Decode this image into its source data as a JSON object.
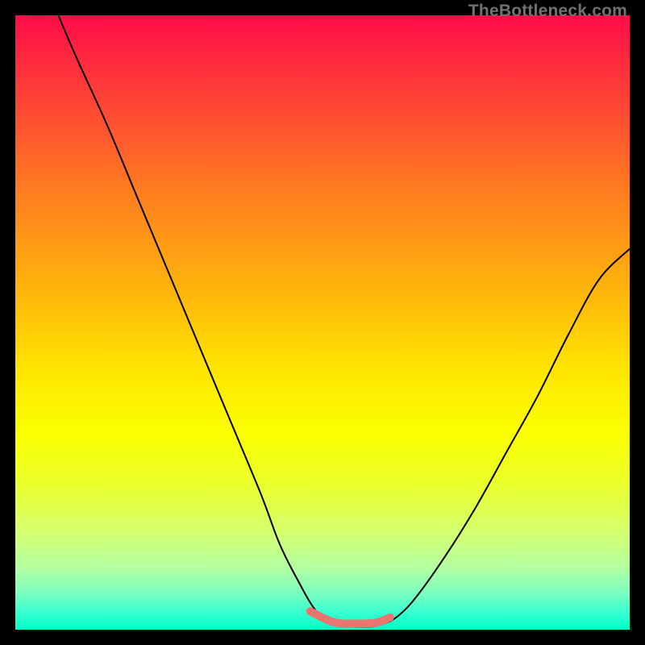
{
  "watermark": "TheBottleneck.com",
  "chart_data": {
    "type": "line",
    "title": "",
    "xlabel": "",
    "ylabel": "",
    "xlim": [
      0,
      100
    ],
    "ylim": [
      0,
      100
    ],
    "grid": false,
    "legend": false,
    "series": [
      {
        "name": "curve",
        "x": [
          7,
          10,
          15,
          20,
          25,
          30,
          35,
          40,
          43,
          46,
          49,
          52,
          55,
          58,
          60,
          62,
          65,
          70,
          75,
          80,
          85,
          90,
          95,
          100
        ],
        "y": [
          100,
          93,
          82,
          70,
          58,
          46,
          34,
          22,
          14,
          8,
          3,
          1,
          0.5,
          0.5,
          1,
          2,
          5,
          12,
          20,
          29,
          38,
          48,
          57,
          62
        ]
      }
    ],
    "highlight_band": {
      "name": "optimal-range",
      "color": "#e97470",
      "x": [
        48,
        51,
        53,
        55,
        57,
        59,
        61
      ],
      "y": [
        3,
        1.5,
        1,
        1,
        1,
        1.2,
        2
      ]
    },
    "background_gradient": {
      "top": "#ff0b47",
      "middle": "#ffe600",
      "bottom": "#00ffc8"
    }
  }
}
